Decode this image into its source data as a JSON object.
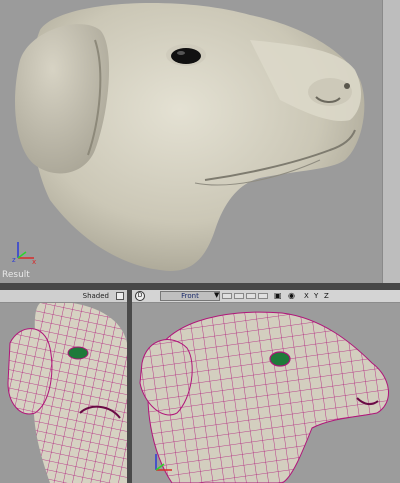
{
  "result_view": {
    "label": "Result"
  },
  "left_view": {
    "shading_label": "Shaded"
  },
  "right_view": {
    "display_button": "D",
    "view_mode": "Front",
    "dropdown_arrow": "▼",
    "axes": [
      "X",
      "Y",
      "Z"
    ]
  },
  "icons": {
    "camera": "camera-icon",
    "eye": "eye-icon"
  },
  "colors": {
    "wireframe": "#b0157a",
    "clay": "#d3cfbf",
    "eye_green": "#1f7a3a"
  }
}
